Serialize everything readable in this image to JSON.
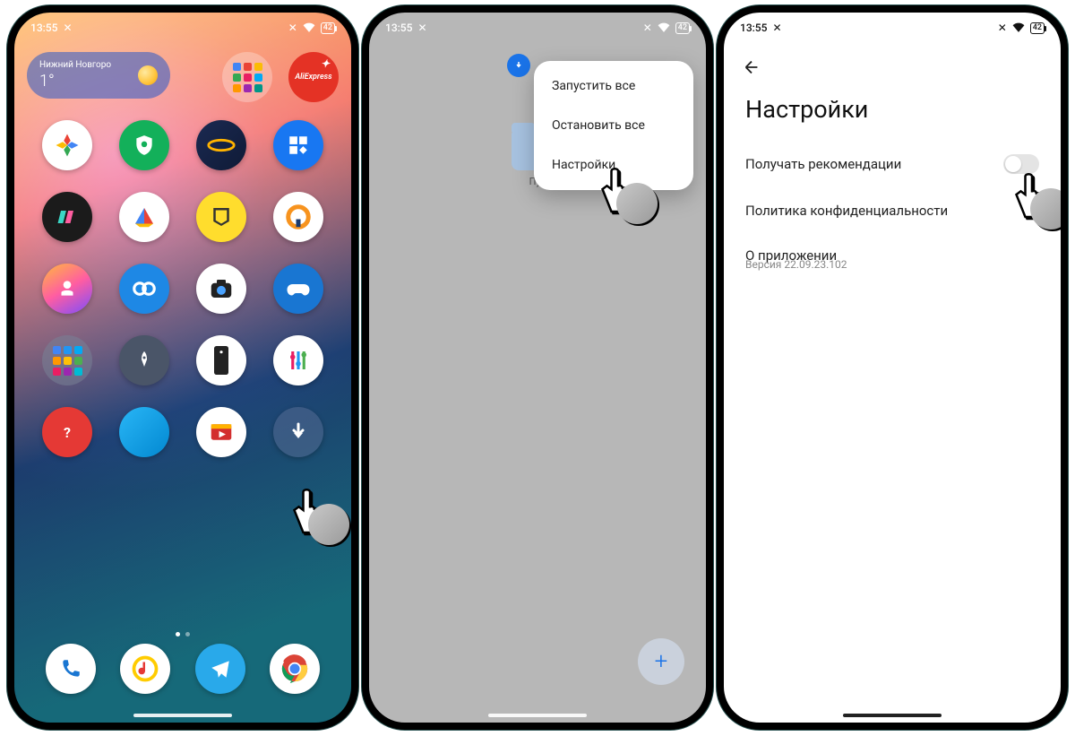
{
  "status": {
    "time": "13:55",
    "battery": "42"
  },
  "phone1": {
    "weather_city": "Нижний Новгоро",
    "weather_temp": "1°",
    "ali_label": "AliExpress",
    "dock": [
      "phone",
      "music",
      "telegram",
      "chrome"
    ]
  },
  "phone2": {
    "folder_label": "Пус",
    "menu": {
      "start_all": "Запустить все",
      "stop_all": "Остановить все",
      "settings": "Настройки"
    },
    "fab": "+"
  },
  "phone3": {
    "title": "Настройки",
    "recommend": "Получать рекомендации",
    "privacy": "Политика конфиденциальности",
    "about": "О приложении",
    "version": "Версия 22.09.23.102"
  }
}
